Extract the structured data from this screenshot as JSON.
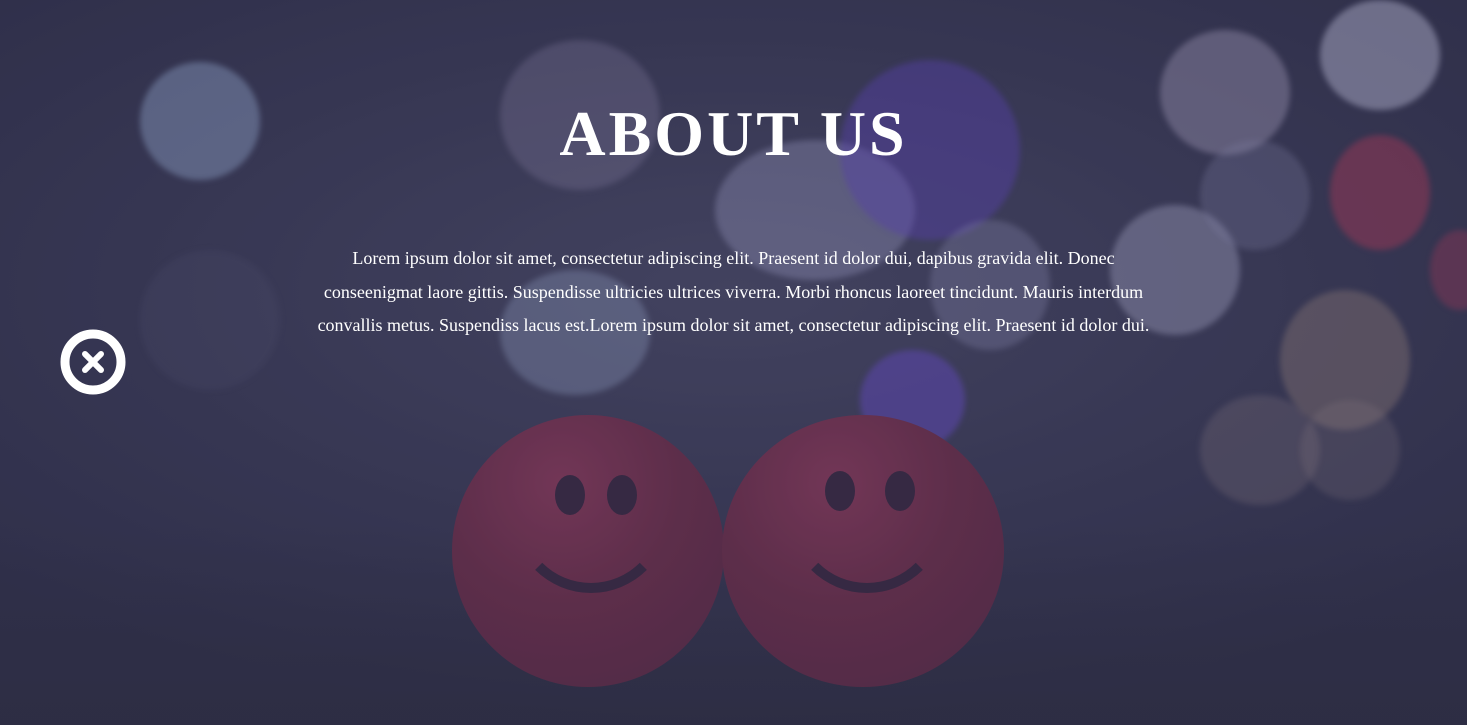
{
  "about": {
    "title": "ABOUT US",
    "description": "Lorem ipsum dolor sit amet, consectetur adipiscing elit. Praesent id dolor dui, dapibus gravida elit. Donec conseenigmat laore gittis. Suspendisse ultricies ultrices viverra. Morbi rhoncus laoreet tincidunt. Mauris interdum convallis metus. Suspendiss lacus est.Lorem ipsum dolor sit amet, consectetur adipiscing elit. Praesent id dolor dui."
  },
  "close_button": {
    "icon": "close-circle-icon"
  },
  "background": {
    "description_icon": "smiley-balls-photo"
  },
  "colors": {
    "text": "#ffffff",
    "overlay": "#3a3a55"
  }
}
